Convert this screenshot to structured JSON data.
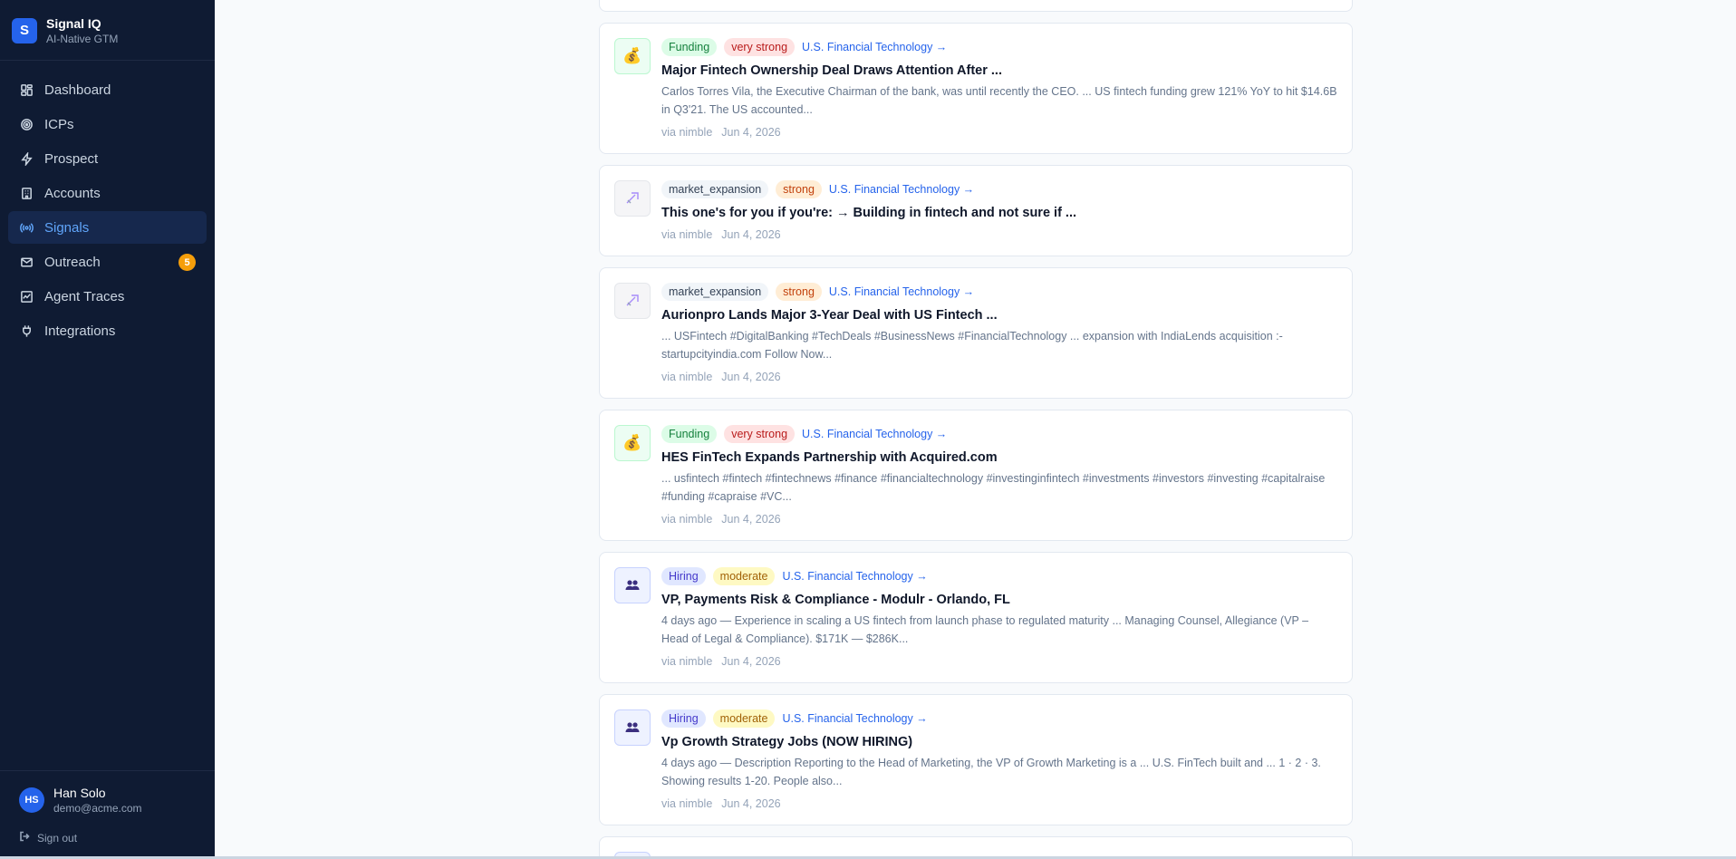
{
  "brand": {
    "logo_letter": "S",
    "name": "Signal IQ",
    "subtitle": "AI-Native GTM"
  },
  "nav": [
    {
      "label": "Dashboard",
      "icon": "dashboard-icon",
      "active": false
    },
    {
      "label": "ICPs",
      "icon": "target-icon",
      "active": false
    },
    {
      "label": "Prospect",
      "icon": "bolt-icon",
      "active": false
    },
    {
      "label": "Accounts",
      "icon": "building-icon",
      "active": false
    },
    {
      "label": "Signals",
      "icon": "radio-icon",
      "active": true
    },
    {
      "label": "Outreach",
      "icon": "mail-icon",
      "active": false,
      "badge": "5"
    },
    {
      "label": "Agent Traces",
      "icon": "trace-icon",
      "active": false
    },
    {
      "label": "Integrations",
      "icon": "plug-icon",
      "active": false
    }
  ],
  "user": {
    "initials": "HS",
    "name": "Han Solo",
    "email": "demo@acme.com",
    "signout_label": "Sign out"
  },
  "signals": [
    {
      "kind": "funding",
      "type": "Funding",
      "strength": "very strong",
      "strength_class": "verystrong",
      "account": "U.S. Financial Technology →",
      "title": "Major Fintech Ownership Deal Draws Attention After ...",
      "snippet": "Carlos Torres Vila, the Executive Chairman of the bank, was until recently the CEO. ... US fintech funding grew 121% YoY to hit $14.6B in Q3'21. The US accounted...",
      "source": "via nimble",
      "date": "Jun 4, 2026"
    },
    {
      "kind": "market",
      "type": "market_expansion",
      "strength": "strong",
      "strength_class": "strong",
      "account": "U.S. Financial Technology →",
      "title": "This one's for you if you're: → Building in fintech and not sure if ...",
      "snippet": "",
      "source": "via nimble",
      "date": "Jun 4, 2026"
    },
    {
      "kind": "market",
      "type": "market_expansion",
      "strength": "strong",
      "strength_class": "strong",
      "account": "U.S. Financial Technology →",
      "title": "Aurionpro Lands Major 3-Year Deal with US Fintech ...",
      "snippet": "... USFintech #DigitalBanking #TechDeals #BusinessNews #FinancialTechnology ... expansion with IndiaLends acquisition :- startupcityindia.com Follow Now...",
      "source": "via nimble",
      "date": "Jun 4, 2026"
    },
    {
      "kind": "funding",
      "type": "Funding",
      "strength": "very strong",
      "strength_class": "verystrong",
      "account": "U.S. Financial Technology →",
      "title": "HES FinTech Expands Partnership with Acquired.com",
      "snippet": "... usfintech #fintech #fintechnews #finance #financialtechnology #investinginfintech #investments #investors #investing #capitalraise #funding #capraise #VC...",
      "source": "via nimble",
      "date": "Jun 4, 2026"
    },
    {
      "kind": "hiring",
      "type": "Hiring",
      "strength": "moderate",
      "strength_class": "moderate",
      "account": "U.S. Financial Technology →",
      "title": "VP, Payments Risk & Compliance - Modulr - Orlando, FL",
      "snippet": "4 days ago — Experience in scaling a US fintech from launch phase to regulated maturity ... Managing Counsel, Allegiance (VP – Head of Legal & Compliance). $171K — $286K...",
      "source": "via nimble",
      "date": "Jun 4, 2026"
    },
    {
      "kind": "hiring",
      "type": "Hiring",
      "strength": "moderate",
      "strength_class": "moderate",
      "account": "U.S. Financial Technology →",
      "title": "Vp Growth Strategy Jobs (NOW HIRING)",
      "snippet": "4 days ago — Description Reporting to the Head of Marketing, the VP of Growth Marketing is a ... U.S. FinTech built and ... 1 · 2 · 3. Showing results 1-20. People also...",
      "source": "via nimble",
      "date": "Jun 4, 2026"
    }
  ]
}
